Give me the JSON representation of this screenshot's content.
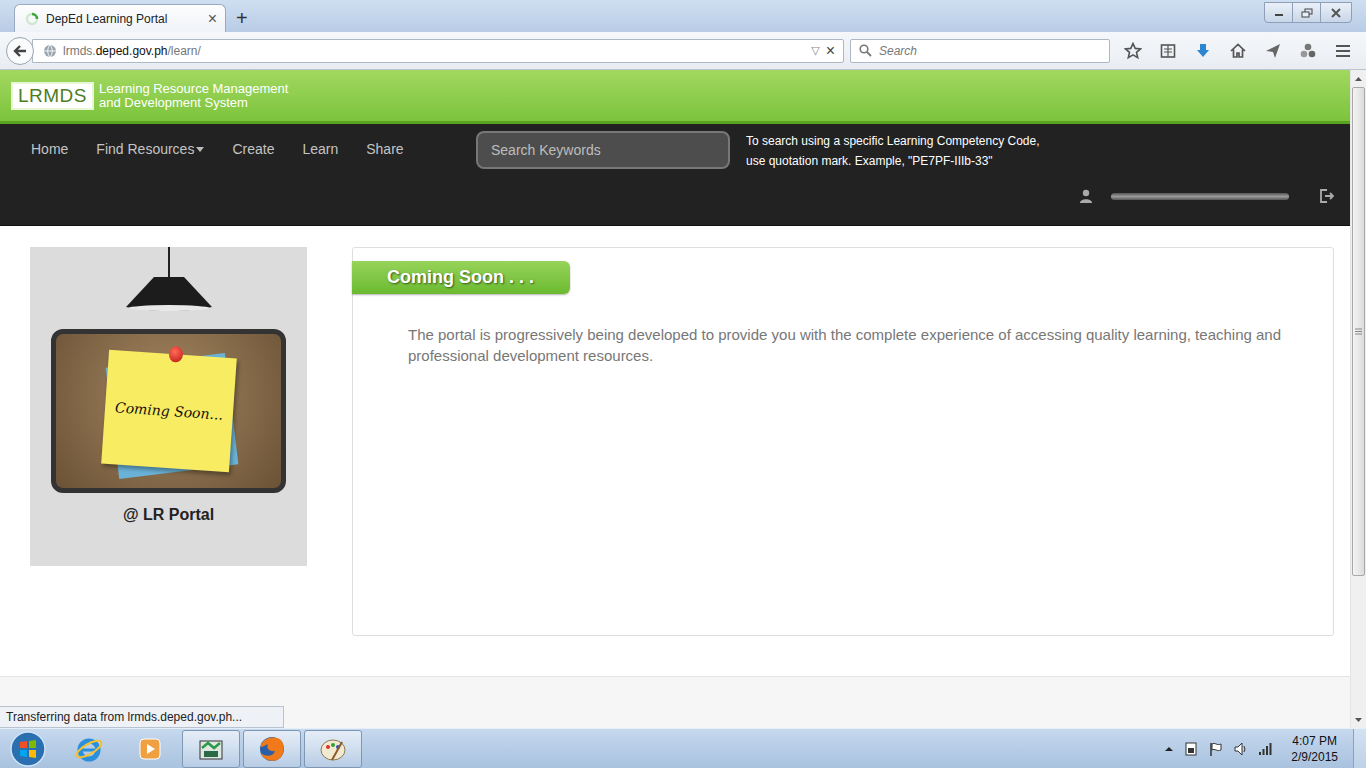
{
  "browser": {
    "tabs": [
      {
        "title": "DepEd Learning Portal",
        "selected": true,
        "loading": true
      }
    ],
    "tab_close": "×",
    "new_tab": "+",
    "url": {
      "prefix": "lrmds.",
      "host": "deped.gov.ph",
      "path": "/learn/"
    },
    "url_dropdown": "▽",
    "url_stop": "×",
    "search_placeholder": "Search",
    "status": "Transferring data from lrmds.deped.gov.ph...",
    "scrollbar": {
      "level": 0.78
    }
  },
  "site": {
    "logo": "LRMDS",
    "title_lines": [
      "Learning Resource Management",
      "and Development System"
    ],
    "menu": [
      {
        "label": "Home",
        "dropdown": false
      },
      {
        "label": "Find Resources",
        "dropdown": true
      },
      {
        "label": "Create",
        "dropdown": false
      },
      {
        "label": "Learn",
        "dropdown": false
      },
      {
        "label": "Share",
        "dropdown": false
      }
    ],
    "search_placeholder": "Search Keywords",
    "search_hint": [
      "To search using a specific Learning Competency Code,",
      "use quotation mark. Example, \"PE7PF-IIIb-33\""
    ],
    "illustration": {
      "note": "Coming Soon...",
      "caption": "@ LR Portal"
    },
    "panel": {
      "heading": "Coming Soon . . .",
      "text": "The portal is progressively being developed to provide you with the complete experience of accessing quality learning, teaching and professional development resources."
    }
  },
  "taskbar": {
    "apps": [
      {
        "kind": "ie",
        "running": false
      },
      {
        "kind": "media",
        "running": false
      },
      {
        "kind": "hp",
        "running": true
      },
      {
        "kind": "firefox",
        "running": true
      },
      {
        "kind": "paint",
        "running": true
      }
    ],
    "time": "4:07 PM",
    "date": "2/9/2015"
  }
}
